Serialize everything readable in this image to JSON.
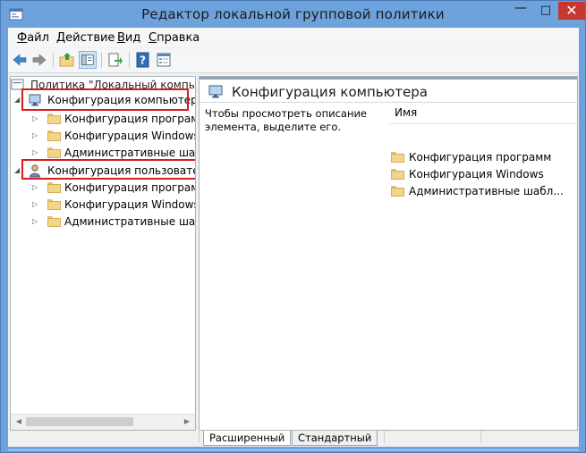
{
  "window": {
    "title": "Редактор локальной групповой политики",
    "minimize_icon": "minimize-icon",
    "maximize_icon": "maximize-icon",
    "close_icon": "close-icon",
    "buttons": {
      "minimize": "—",
      "maximize": "□",
      "close": "✕"
    }
  },
  "menu": {
    "items": [
      {
        "label": "Файл",
        "accel": "Ф",
        "rest": "айл"
      },
      {
        "label": "Действие",
        "accel": "Д",
        "rest": "ействие"
      },
      {
        "label": "Вид",
        "accel": "В",
        "rest": "ид"
      },
      {
        "label": "Справка",
        "accel": "С",
        "rest": "правка"
      }
    ]
  },
  "toolbar": {
    "icons": [
      "back-arrow-icon",
      "forward-arrow-icon",
      "up-folder-icon",
      "show-hide-tree-icon",
      "export-list-icon",
      "help-icon",
      "properties-icon"
    ]
  },
  "tree": {
    "root": "Политика \"Локальный компьютер\"",
    "computer_config": "Конфигурация компьютера",
    "user_config": "Конфигурация пользователя",
    "children": [
      "Конфигурация программ",
      "Конфигурация Windows",
      "Административные шаблоны"
    ]
  },
  "details": {
    "title": "Конфигурация компьютера",
    "description": "Чтобы просмотреть описание элемента, выделите его.",
    "column_name": "Имя",
    "items": [
      "Конфигурация программ",
      "Конфигурация Windows",
      "Административные шабл..."
    ]
  },
  "tabs": {
    "extended": "Расширенный",
    "standard": "Стандартный"
  },
  "colors": {
    "highlight_box": "#d51b1b",
    "title_bar": "#6ea2dd",
    "close_button": "#c7372f"
  }
}
